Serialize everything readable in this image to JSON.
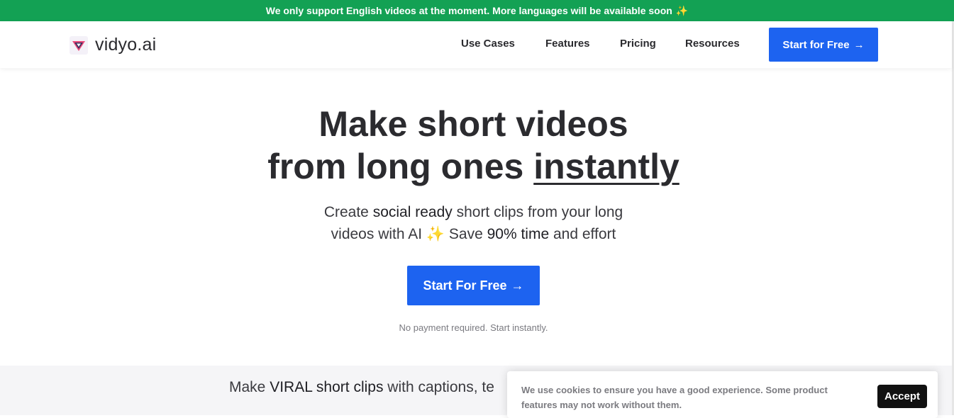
{
  "banner": {
    "text": "We only support English videos at the moment. More languages will be available soon",
    "emoji": "✨"
  },
  "nav": {
    "logo_text": "vidyo.ai",
    "links": [
      "Use Cases",
      "Features",
      "Pricing",
      "Resources"
    ],
    "cta_label": "Start for Free",
    "cta_arrow": "→"
  },
  "hero": {
    "title_line1": "Make short videos",
    "title_line2_prefix": "from long ones ",
    "title_line2_emph": "instantly",
    "sub_p1": "Create ",
    "sub_b1": "social ready",
    "sub_p2": " short clips from your long",
    "sub_p3": "videos with AI ",
    "sub_emoji": "✨",
    "sub_p4": " Save ",
    "sub_b2": "90% time",
    "sub_p5": " and effort",
    "cta_label": "Start For Free",
    "cta_arrow": "→",
    "note": "No payment required. Start instantly."
  },
  "lower": {
    "p1": "Make ",
    "b1": "VIRAL short clips",
    "p2": " with captions, te"
  },
  "cookie": {
    "text": "We use cookies to ensure you have a good experience. Some product features may not work without them.",
    "accept_label": "Accept"
  },
  "colors": {
    "banner_bg": "#13a154",
    "primary_blue": "#1d63f0",
    "text_dark": "#2b2b2f",
    "accept_bg": "#111111"
  }
}
